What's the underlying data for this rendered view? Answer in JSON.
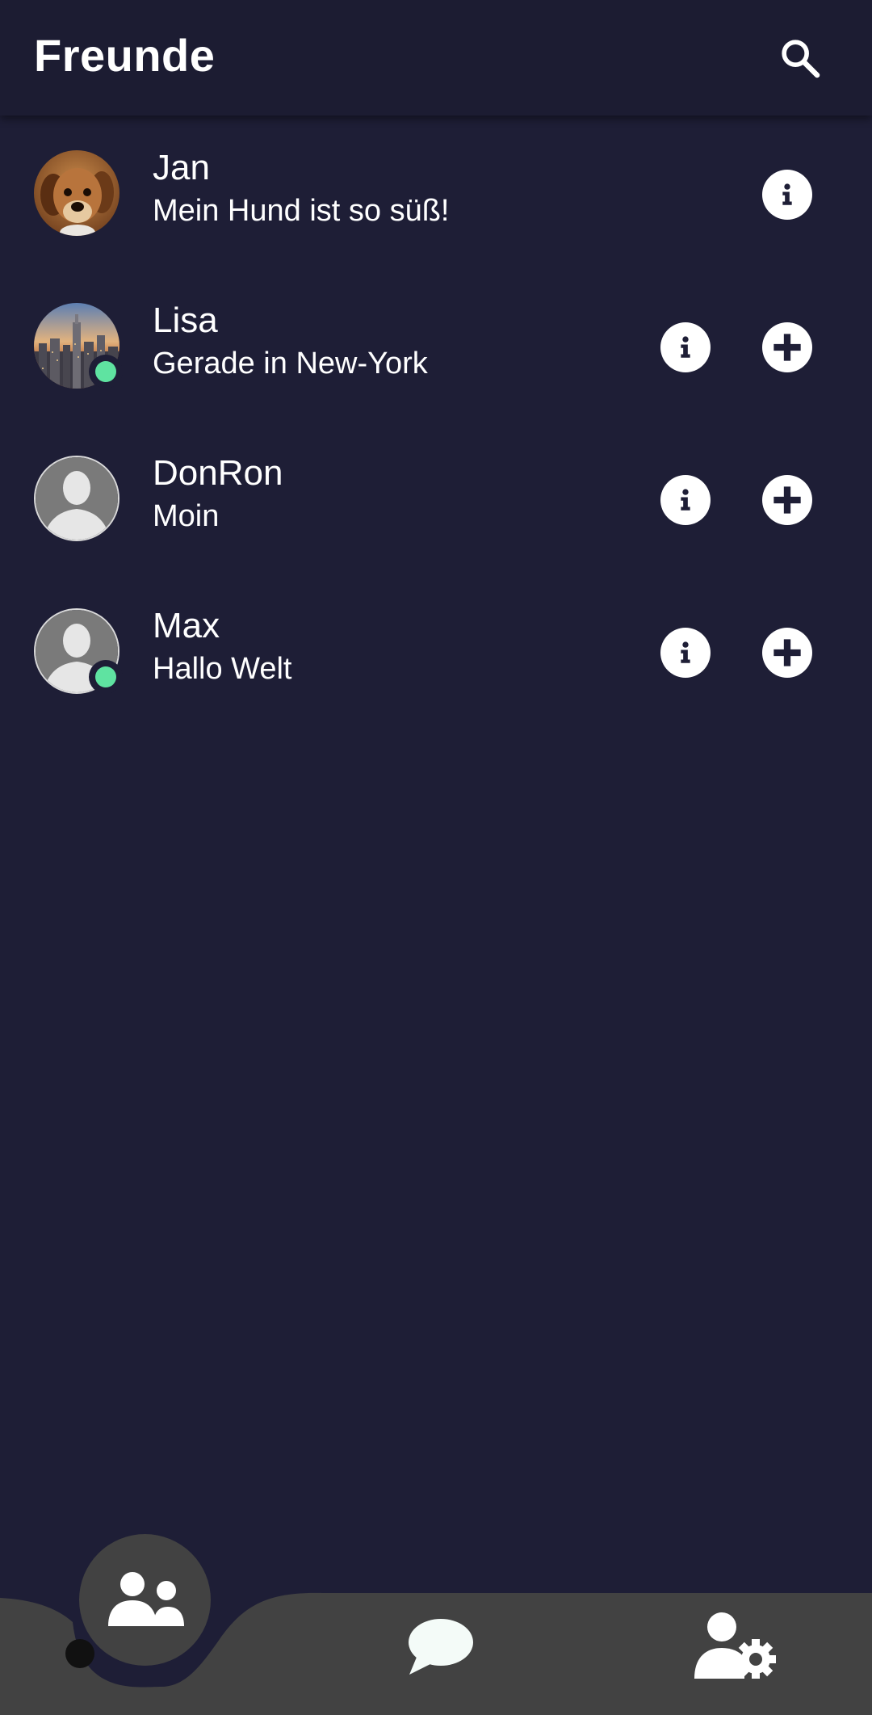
{
  "app_bar": {
    "title": "Freunde",
    "search_icon": "search-icon"
  },
  "friends": [
    {
      "name": "Jan",
      "status": "Mein Hund ist so süß!",
      "avatar": "dog-photo",
      "online": false,
      "can_add": false
    },
    {
      "name": "Lisa",
      "status": "Gerade in New-York",
      "avatar": "city-photo",
      "online": true,
      "can_add": true
    },
    {
      "name": "DonRon",
      "status": "Moin",
      "avatar": "default-avatar",
      "online": false,
      "can_add": true
    },
    {
      "name": "Max",
      "status": "Hallo Welt",
      "avatar": "default-avatar",
      "online": true,
      "can_add": true
    }
  ],
  "bottom_nav": {
    "items": [
      {
        "icon": "users-icon",
        "active": true
      },
      {
        "icon": "chat-bubble-icon",
        "active": false
      },
      {
        "icon": "user-settings-icon",
        "active": false
      }
    ]
  },
  "colors": {
    "background": "#1e1e36",
    "app_bar": "#1c1c32",
    "nav_bar": "#424242",
    "online": "#5fe3a1",
    "icon_fill": "#ffffff"
  }
}
